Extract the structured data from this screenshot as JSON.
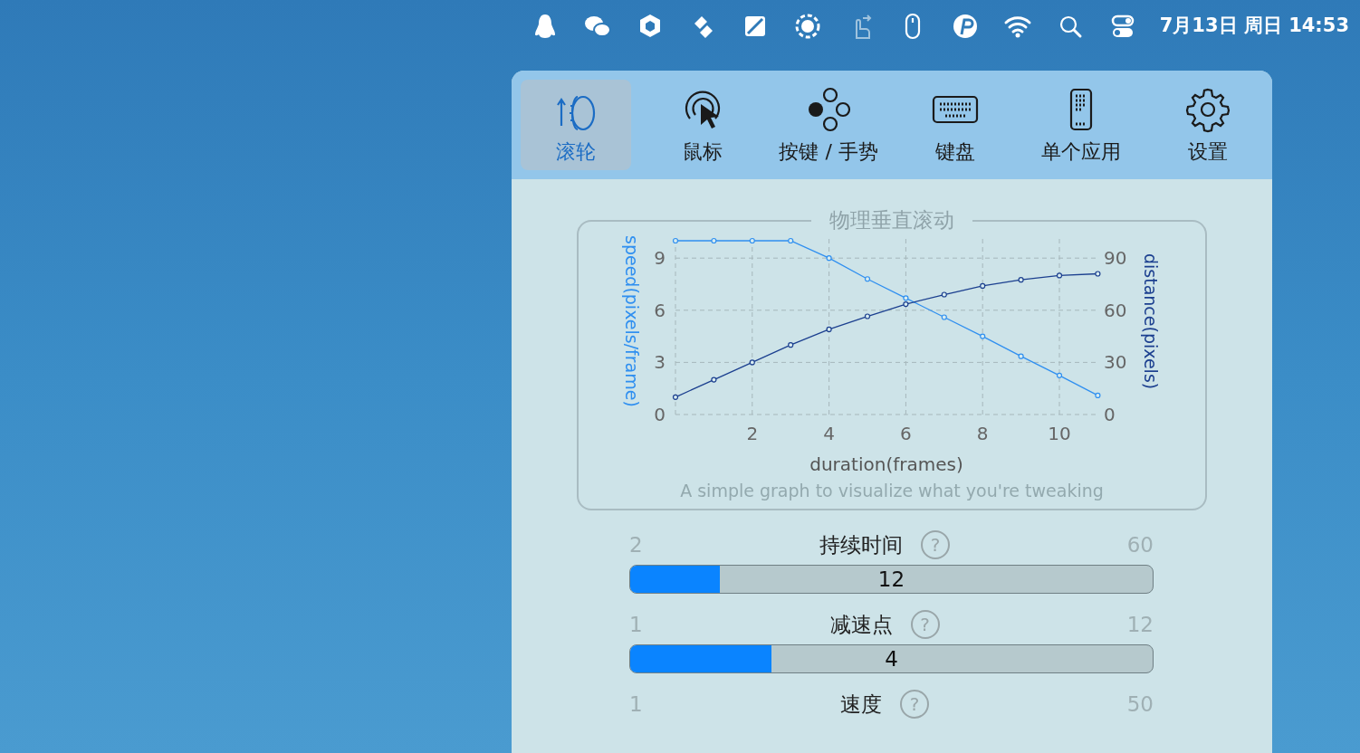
{
  "menu_bar": {
    "clock": "7月13日 周日 14:53"
  },
  "tabs": [
    {
      "label": "滚轮",
      "selected": true
    },
    {
      "label": "鼠标",
      "selected": false
    },
    {
      "label": "按键 / 手势",
      "selected": false
    },
    {
      "label": "键盘",
      "selected": false
    },
    {
      "label": "单个应用",
      "selected": false
    },
    {
      "label": "设置",
      "selected": false
    }
  ],
  "panel": {
    "title": "物理垂直滚动",
    "caption": "A simple graph to visualize what you're tweaking",
    "chart_data": {
      "type": "line",
      "xlabel": "duration(frames)",
      "ylabel": "speed(pixels/frame)",
      "y2label": "distance(pixels)",
      "x": [
        0,
        1,
        2,
        3,
        4,
        5,
        6,
        7,
        8,
        9,
        10,
        11
      ],
      "series": [
        {
          "color": "#2f8ff0",
          "marker": "circle",
          "values": [
            10,
            10,
            10,
            10,
            9,
            7.8,
            6.7,
            5.6,
            4.5,
            3.35,
            2.25,
            1.1
          ]
        },
        {
          "color": "#1b3f8f",
          "marker": "circle",
          "axis": "y2",
          "values": [
            10,
            20,
            30,
            40,
            49,
            56.5,
            63.5,
            69,
            74,
            77.5,
            80,
            81
          ]
        }
      ],
      "grid": true,
      "xlim": [
        0,
        11
      ],
      "ylim": [
        0,
        10.2
      ],
      "xticks": [
        2,
        4,
        6,
        8,
        10
      ],
      "yticks": [
        0,
        3,
        6,
        9
      ],
      "y2lim": [
        0,
        102
      ],
      "y2ticks": [
        0,
        30,
        60,
        90
      ]
    }
  },
  "sliders": [
    {
      "min": "2",
      "label": "持续时间",
      "help": "?",
      "max": "60",
      "value": "12",
      "level": 0.172
    },
    {
      "min": "1",
      "label": "减速点",
      "help": "?",
      "max": "12",
      "value": "4",
      "level": 0.27
    },
    {
      "min": "1",
      "label": "速度",
      "help": "?",
      "max": "50"
    }
  ]
}
